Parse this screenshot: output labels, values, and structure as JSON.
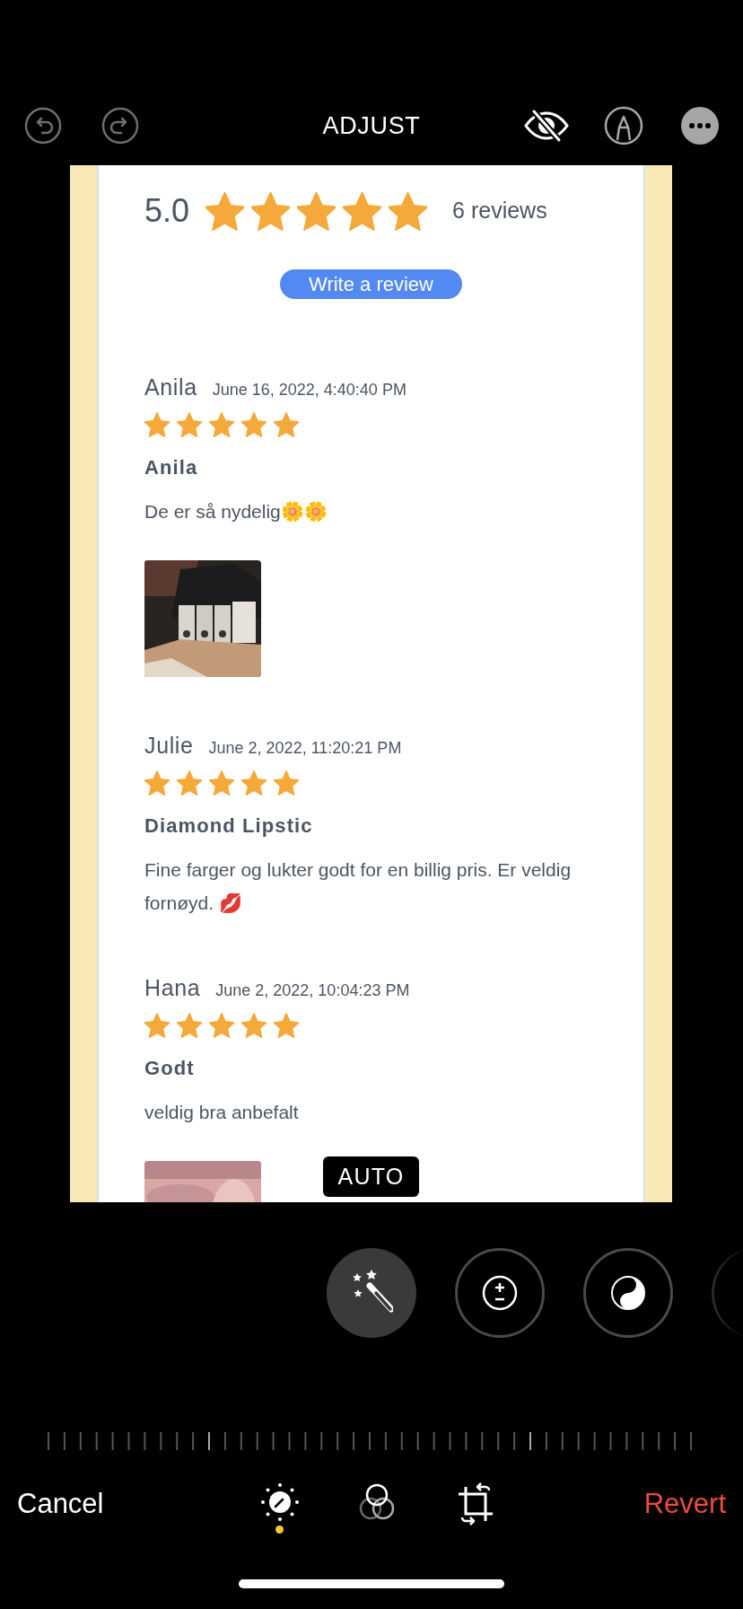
{
  "top_bar": {
    "title": "ADJUST"
  },
  "preview": {
    "rating": "5.0",
    "stars": 5,
    "review_count": "6 reviews",
    "write_button": "Write a review",
    "reviews": [
      {
        "name": "Anila",
        "date": "June 16, 2022, 4:40:40 PM",
        "stars": 5,
        "title": "Anila",
        "body": "De er så nydelig🌼🌼"
      },
      {
        "name": "Julie",
        "date": "June 2, 2022, 11:20:21 PM",
        "stars": 5,
        "title": "Diamond Lipstic",
        "body": "Fine farger og lukter godt for en billig pris. Er veldig fornøyd. 💋"
      },
      {
        "name": "Hana",
        "date": "June 2, 2022, 10:04:23 PM",
        "stars": 5,
        "title": "Godt",
        "body": "veldig bra anbefalt"
      }
    ]
  },
  "auto_badge": "AUTO",
  "tools": [
    {
      "kind": "auto",
      "selected": true
    },
    {
      "kind": "exposure",
      "selected": false
    },
    {
      "kind": "brilliance",
      "selected": false
    },
    {
      "kind": "more",
      "selected": false
    }
  ],
  "tabs": [
    {
      "kind": "adjust",
      "selected": true
    },
    {
      "kind": "filters",
      "selected": false
    },
    {
      "kind": "crop",
      "selected": false
    }
  ],
  "cancel": "Cancel",
  "revert": "Revert"
}
